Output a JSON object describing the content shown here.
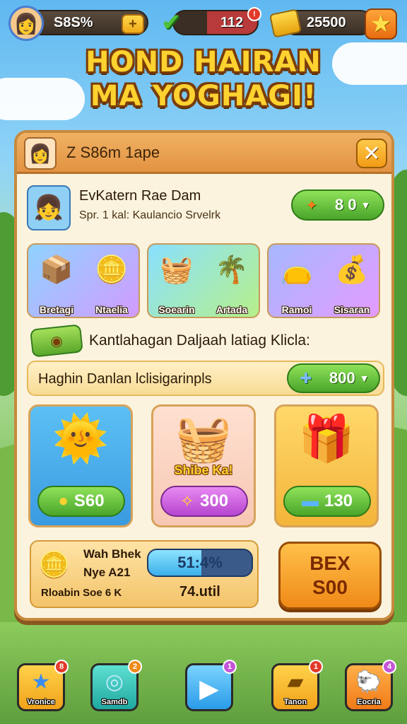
{
  "topbar": {
    "player_value": "S8S%",
    "player_plus": "+",
    "energy_value": "112",
    "energy_badge": "!",
    "gold_value": "25500",
    "star_icon": "star-icon"
  },
  "title": {
    "line1": "HOND HAIRAN",
    "line2": "MA YOGHAGI!"
  },
  "panel": {
    "header_text": "Z S86m 1ape",
    "close_label": "✕",
    "player": {
      "name": "EvKatern Rae Dam",
      "subtitle": "Spr. 1 kal: Kaulancio Srvelrk",
      "currency_value": "8 0"
    },
    "categories": [
      {
        "items": [
          {
            "label": "Bretagi",
            "icon": "treasure-chest-icon"
          },
          {
            "label": "Ntaelia",
            "icon": "coin-stack-icon"
          }
        ]
      },
      {
        "items": [
          {
            "label": "Soearin",
            "icon": "basket-icon"
          },
          {
            "label": "Artada",
            "icon": "plant-gold-icon"
          }
        ]
      },
      {
        "items": [
          {
            "label": "Ramoi",
            "icon": "red-bag-icon"
          },
          {
            "label": "Sisaran",
            "icon": "coin-pile-icon"
          }
        ]
      }
    ],
    "info_text": "Kantlahagan Daljaah latiag Klicla:",
    "banner": {
      "text": "Haghin Danlan lclisigarinpls",
      "value": "800"
    },
    "shop": [
      {
        "name": "sun-character",
        "price": "S60",
        "label": ""
      },
      {
        "name": "treasure-basket",
        "price": "300",
        "label": "Shibe Ka!"
      },
      {
        "name": "red-gift-box",
        "price": "130",
        "label": ""
      }
    ],
    "quest": {
      "line1": "Wah Bhek",
      "line2": "Nye A21",
      "line3": "Rloabin Soe 6 K",
      "progress_text": "51:4%",
      "progress_value": 0.514,
      "amount": "74.util"
    },
    "big_button": {
      "line1": "BEX",
      "line2": "S00"
    }
  },
  "nav": [
    {
      "label": "Vronice",
      "badge": "8",
      "icon": "star-icon"
    },
    {
      "label": "Samdb",
      "badge": "2",
      "icon": "orb-icon"
    },
    {
      "label": "",
      "badge": "1",
      "icon": "play-icon"
    },
    {
      "label": "Tanon",
      "badge": "1",
      "icon": "ticket-icon"
    },
    {
      "label": "Eocria",
      "badge": "4",
      "icon": "sheep-icon"
    }
  ],
  "colors": {
    "panel_bg": "#fbf3dd",
    "accent_orange": "#f29b15",
    "accent_green": "#4aa52a",
    "accent_purple": "#c455d8",
    "title_gold": "#ffd230"
  }
}
